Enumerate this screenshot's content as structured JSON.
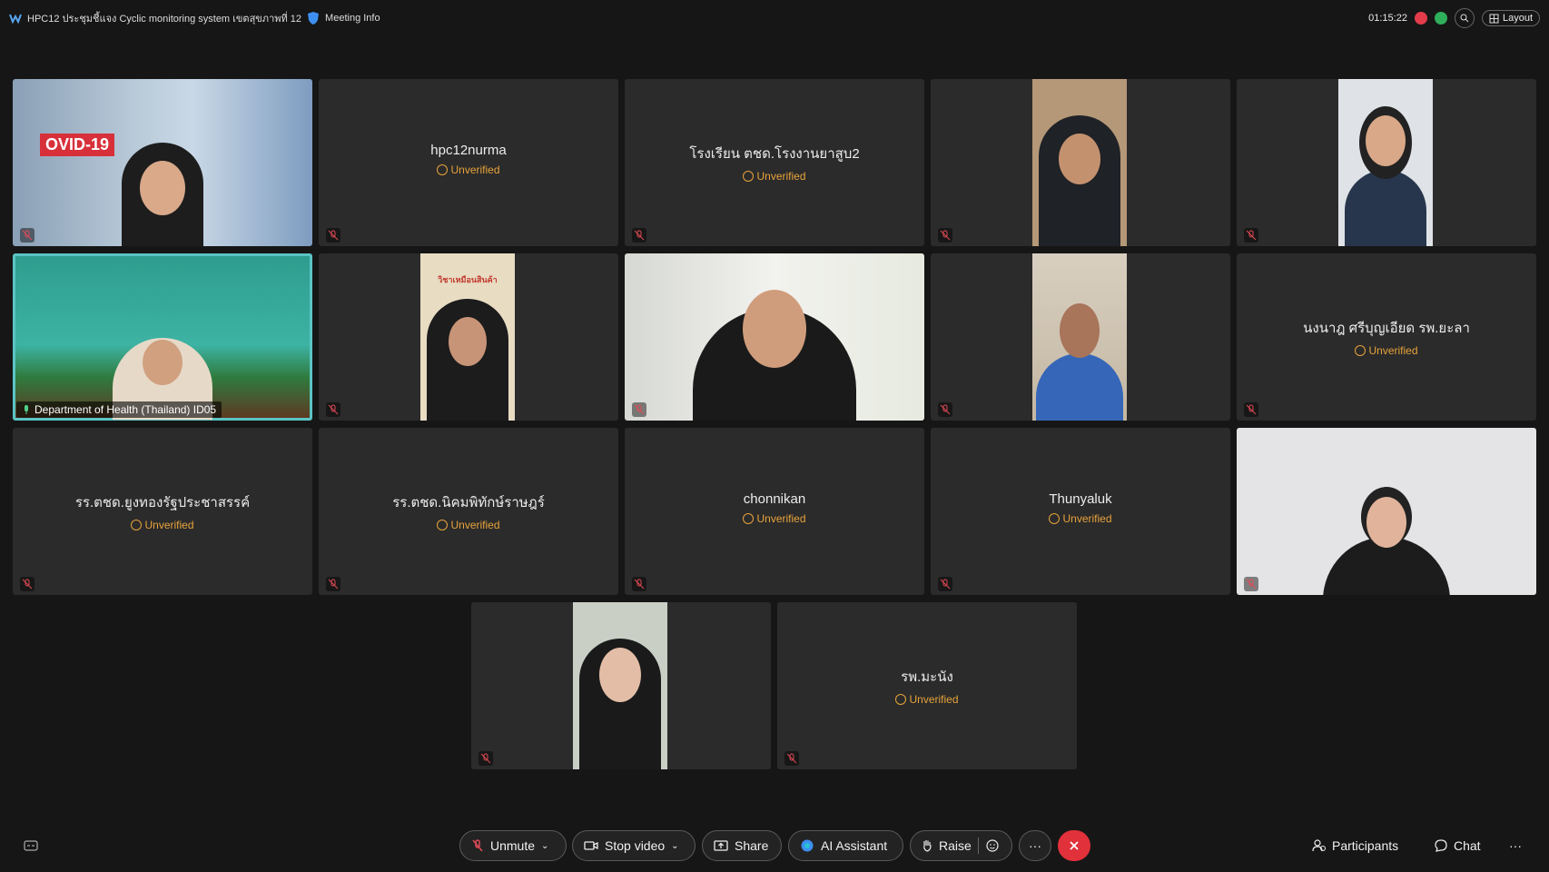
{
  "header": {
    "meeting_title": "HPC12 ประชุมชี้แจง Cyclic monitoring system เขตสุขภาพที่ 12",
    "meeting_info_label": "Meeting Info",
    "elapsed_time": "01:15:22",
    "layout_label": "Layout"
  },
  "unverified_label": "Unverified",
  "participants": {
    "p1": {
      "name": ""
    },
    "p2": {
      "name": "hpc12nurma"
    },
    "p3": {
      "name": "โรงเรียน ตชด.โรงงานยาสูบ2"
    },
    "p4": {
      "name": ""
    },
    "p5": {
      "name": ""
    },
    "p6": {
      "name": "Department of Health (Thailand) ID05"
    },
    "p7": {
      "name": ""
    },
    "p8": {
      "name": ""
    },
    "p9": {
      "name": ""
    },
    "p10": {
      "name": "นงนาฎ ศรีบุญเอียด รพ.ยะลา"
    },
    "p11": {
      "name": "รร.ตชด.ยูงทองรัฐประชาสรรค์"
    },
    "p12": {
      "name": "รร.ตชด.นิคมพิทักษ์ราษฎร์"
    },
    "p13": {
      "name": "chonnikan"
    },
    "p14": {
      "name": "Thunyaluk"
    },
    "p15": {
      "name": ""
    },
    "p16": {
      "name": ""
    },
    "p17": {
      "name": "รพ.มะนัง"
    }
  },
  "video_banners": {
    "covid_text": "OVID-19",
    "poster_text": "วิชาเหมือนสินค้า"
  },
  "toolbar": {
    "unmute": "Unmute",
    "stop_video": "Stop video",
    "share": "Share",
    "ai_assistant": "AI Assistant",
    "raise": "Raise",
    "more": "···",
    "participants": "Participants",
    "chat": "Chat",
    "overflow": "···"
  },
  "colors": {
    "background": "#161616",
    "tile": "#2b2b2b",
    "unverified": "#e7a33b",
    "active_speaker": "#5bc4c5",
    "end_call": "#e1313b",
    "recording": "#e23c4a"
  }
}
